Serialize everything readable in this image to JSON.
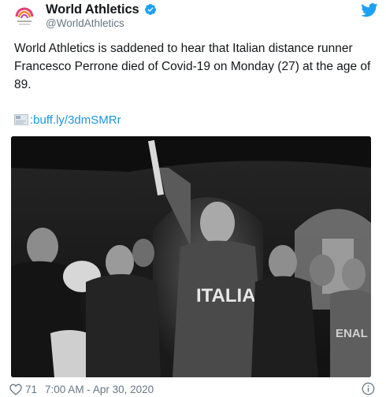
{
  "author": {
    "display_name": "World Athletics",
    "handle": "@WorldAthletics",
    "verified_icon": "verified-badge-icon",
    "avatar_icon": "world-athletics-logo"
  },
  "tweet": {
    "text": "World Athletics is saddened to hear that Italian distance runner Francesco Perrone died of Covid-19 on Monday (27) at the age of 89.",
    "link_text": ":buff.ly/3dmSMRr"
  },
  "photo": {
    "jersey_text": "ITALIA",
    "badge_text": "ENAL"
  },
  "footer": {
    "like_count": "71",
    "timestamp": "7:00 AM - Apr 30, 2020"
  },
  "colors": {
    "brand_blue": "#1da1f2",
    "link_blue": "#1b95e0",
    "muted_gray": "#657786"
  }
}
